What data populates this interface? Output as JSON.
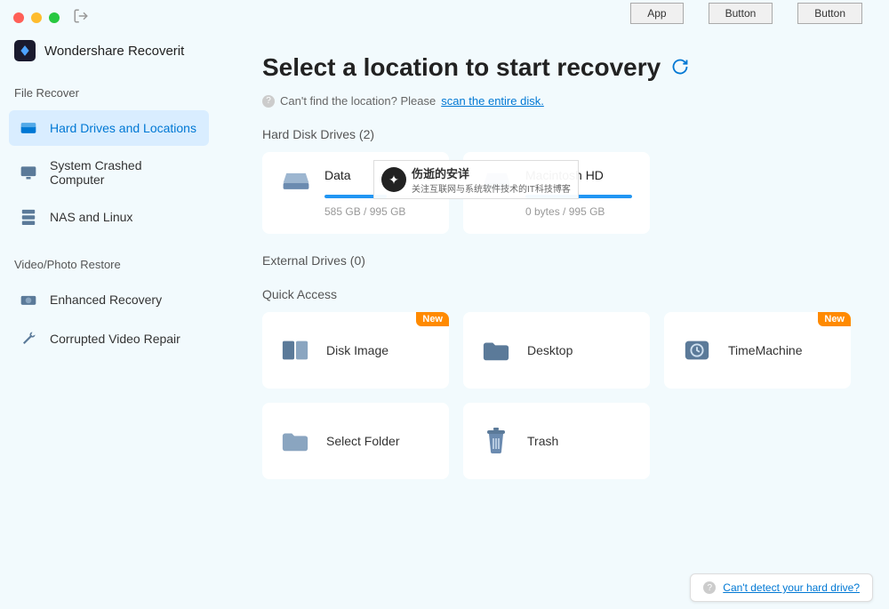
{
  "app": {
    "name": "Wondershare Recoverit"
  },
  "topButtons": [
    "App",
    "Button",
    "Button"
  ],
  "sidebar": {
    "sections": [
      {
        "label": "File Recover",
        "items": [
          {
            "label": "Hard Drives and Locations",
            "icon": "drive",
            "active": true
          },
          {
            "label": "System Crashed Computer",
            "icon": "monitor",
            "active": false
          },
          {
            "label": "NAS and Linux",
            "icon": "server",
            "active": false
          }
        ]
      },
      {
        "label": "Video/Photo Restore",
        "items": [
          {
            "label": "Enhanced Recovery",
            "icon": "camera",
            "active": false
          },
          {
            "label": "Corrupted Video Repair",
            "icon": "wrench",
            "active": false
          }
        ]
      }
    ]
  },
  "main": {
    "title": "Select a location to start recovery",
    "subtitlePrefix": "Can't find the location? Please ",
    "subtitleLink": "scan the entire disk.",
    "hardDisk": {
      "title": "Hard Disk Drives (2)",
      "drives": [
        {
          "name": "Data",
          "used": "585 GB",
          "total": "995 GB",
          "fillPct": 58
        },
        {
          "name": "Macintosh HD",
          "used": "0 bytes",
          "total": "995 GB",
          "fillPct": 100
        }
      ]
    },
    "external": {
      "title": "External Drives (0)"
    },
    "quick": {
      "title": "Quick Access",
      "items": [
        {
          "label": "Disk Image",
          "icon": "diskimage",
          "new": true
        },
        {
          "label": "Desktop",
          "icon": "folder-dark",
          "new": false
        },
        {
          "label": "TimeMachine",
          "icon": "timemachine",
          "new": true
        },
        {
          "label": "Select Folder",
          "icon": "folder-light",
          "new": false
        },
        {
          "label": "Trash",
          "icon": "trash",
          "new": false
        }
      ]
    }
  },
  "footer": {
    "helpLink": "Can't detect your hard drive?"
  },
  "watermark": {
    "title": "伤逝的安详",
    "sub": "关注互联网与系统软件技术的IT科技博客"
  },
  "badges": {
    "new": "New"
  }
}
